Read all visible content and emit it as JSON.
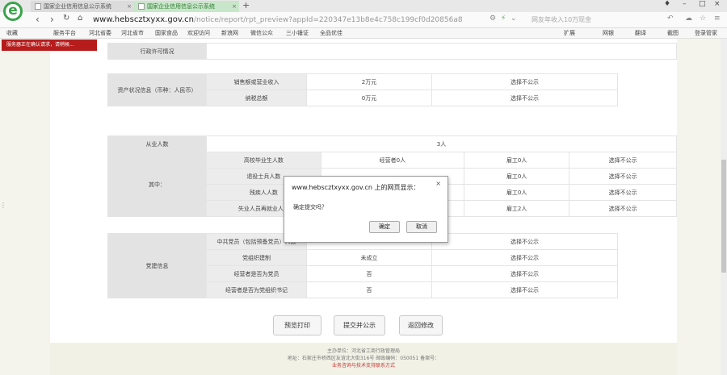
{
  "browser": {
    "tabs": [
      {
        "label": "国家企业信用信息公示系统",
        "close": "×"
      },
      {
        "label": "国家企业信用信息公示系统",
        "close": "×"
      }
    ],
    "new_tab": "+",
    "logo_glyph": "e",
    "url_host": "www.hebscztxyxx.gov.cn",
    "url_path": "/notice/report/rpt_preview?appId=220347e13b8e4c758c199cf0d20856a8",
    "search_text": "网友年收入10万现金",
    "nav_glyphs": {
      "back": "‹",
      "forward": "›",
      "refresh": "↻",
      "home": "⌂",
      "star": "☆"
    },
    "bookmarks": [
      "收藏",
      "服务平台",
      "河北省委",
      "河北省市",
      "国家食品",
      "欢迎访问",
      "新浪网",
      "微信公众",
      "三小锤证",
      "全品优佳"
    ],
    "right_tools": [
      "扩展",
      "网银",
      "翻译",
      "截图",
      "登录管家"
    ],
    "notice": "服务器正在确认请求，请稍候..."
  },
  "report": {
    "licensing_label": "行政许可情况",
    "assets": {
      "group_label": "资产状况信息（币种：人民币）",
      "rows": [
        {
          "label": "销售额或营业收入",
          "value": "2万元",
          "publicity": "选择不公示"
        },
        {
          "label": "纳税总额",
          "value": "0万元",
          "publicity": "选择不公示"
        }
      ]
    },
    "employees": {
      "label": "从业人数",
      "value": "3人",
      "group_label": "其中：",
      "rows": [
        {
          "label": "高校毕业生人数",
          "operator": "经营者0人",
          "hired": "雇工0人",
          "publicity": "选择不公示"
        },
        {
          "label": "退役士兵人数",
          "operator": "",
          "hired": "雇工0人",
          "publicity": "选择不公示"
        },
        {
          "label": "残疾人人数",
          "operator": "",
          "hired": "雇工0人",
          "publicity": "选择不公示"
        },
        {
          "label": "失业人员再就业人数",
          "operator": "",
          "hired": "雇工2人",
          "publicity": "选择不公示"
        }
      ]
    },
    "party": {
      "group_label": "党建信息",
      "rows": [
        {
          "label": "中共党员（包括预备党员）人数",
          "value": "",
          "publicity": "选择不公示"
        },
        {
          "label": "党组织建制",
          "value": "未成立",
          "publicity": "选择不公示"
        },
        {
          "label": "经营者是否为党员",
          "value": "否",
          "publicity": "选择不公示"
        },
        {
          "label": "经营者是否为党组织书记",
          "value": "否",
          "publicity": "选择不公示"
        }
      ]
    },
    "buttons": {
      "print": "预览打印",
      "submit": "提交并公示",
      "back": "返回修改"
    }
  },
  "footer": {
    "line1": "主办单位：河北省工商行政管理局",
    "line2": "地址：石家庄市桥西区友谊北大街316号 邮政编码：050051 备案号：",
    "line3": "业务咨询与技术支持联系方式"
  },
  "dialog": {
    "title": "www.hebscztxyxx.gov.cn 上的网页显示：",
    "close": "×",
    "message": "确定提交吗？",
    "ok": "确定",
    "cancel": "取消"
  }
}
